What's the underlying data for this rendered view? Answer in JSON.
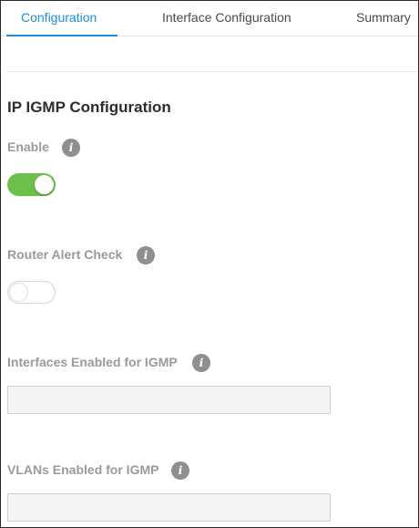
{
  "tabs": [
    {
      "label": "Configuration",
      "active": true
    },
    {
      "label": "Interface Configuration",
      "active": false
    },
    {
      "label": "Summary",
      "active": false
    }
  ],
  "section": {
    "title": "IP IGMP Configuration"
  },
  "fields": {
    "enable": {
      "label": "Enable",
      "state": "on",
      "icon": "info-icon"
    },
    "router_alert_check": {
      "label": "Router Alert Check",
      "state": "off",
      "icon": "info-icon"
    },
    "interfaces_enabled": {
      "label": "Interfaces Enabled for IGMP",
      "value": "",
      "icon": "info-icon"
    },
    "vlans_enabled": {
      "label": "VLANs Enabled for IGMP",
      "value": "",
      "icon": "info-icon"
    }
  },
  "icon_glyph": "i",
  "colors": {
    "accent": "#1a8fd6",
    "toggle_on": "#6cc04a",
    "label_gray": "#9a9a9a",
    "info_icon": "#8f8f8f"
  }
}
